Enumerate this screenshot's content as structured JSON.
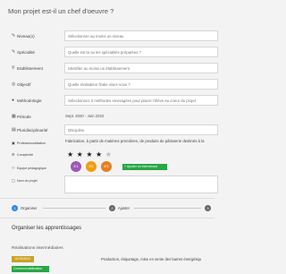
{
  "title": "Mon projet est-il un chef d'oeuvre ?",
  "form": {
    "niveau": {
      "label": "Niveau(x)",
      "placeholder": "Sélectionner au moins un niveau"
    },
    "specialite": {
      "label": "Spécialité",
      "placeholder": "Quelle est la ou les spécialités préparées ?"
    },
    "etablissement": {
      "label": "Etablissement",
      "placeholder": "Identifier au moins un établissement"
    },
    "objectif": {
      "label": "Objectif",
      "placeholder": "Quelle réalisation finale visez-vous ?"
    },
    "methodologie": {
      "label": "Méthodologie",
      "placeholder": "Sélectionnez 3 méthodes envisagées pour placer l'élève au coeur du projet"
    },
    "periode": {
      "label": "Période",
      "value": "Sept. 2020 - Juin 2022"
    },
    "pluridisciplinarite": {
      "label": "Pluridisciplinarité",
      "value": "Discipline"
    }
  },
  "details": {
    "professionnalisation": "Professionnalisation",
    "complexite": "Complexité",
    "equipe": "Equipe pédagogique",
    "nom_projet": "Nom du projet",
    "description": "Fabrication, à partir de matières premières, de produits de pâtisserie destinés à la",
    "rating": {
      "value": 4,
      "max": 5
    },
    "team": [
      {
        "initials": "E1",
        "color": "#9b59b6"
      },
      {
        "initials": "E2",
        "color": "#f39c12"
      },
      {
        "initials": "E3",
        "color": "#e67e22"
      }
    ],
    "add_member_label": "Ajouter un intervenant"
  },
  "stepper": [
    {
      "number": "1",
      "label": "Organiser",
      "color": "#2d89ef"
    },
    {
      "number": "2",
      "label": "Ajuster",
      "color": "#666666"
    },
    {
      "number": "3",
      "label": "",
      "color": "#666666"
    }
  ],
  "learning": {
    "heading": "Organiser les apprentissages",
    "subheading": "Réalisations intermédiaires",
    "date_tag": "01/03/2021",
    "competence_tag": "Communicabilisation",
    "task": "Production, étiquetage, mise en vente des barres énergétiqu"
  }
}
